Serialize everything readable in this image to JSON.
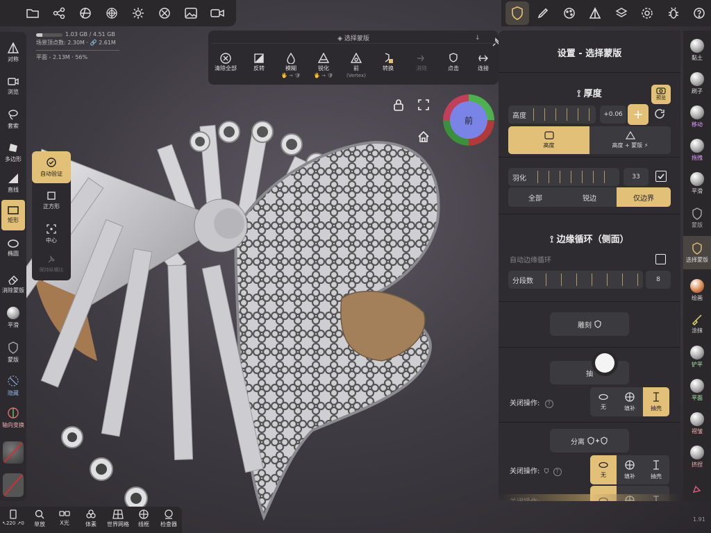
{
  "stats": {
    "memory": "1.03 GB / 4.51 GB",
    "vertices": "场景顶点数: 2.30M · 🔗 2.61M",
    "plane": "平面 - 2.13M · 56%"
  },
  "left_tools": [
    "对称",
    "浏览",
    "套索",
    "多边形",
    "直线",
    "矩形",
    "椭圆",
    "消除蒙版",
    "平滑",
    "蒙版",
    "隐藏",
    "轴向变换"
  ],
  "left_sub": [
    "自动验证",
    "正方形",
    "中心",
    "保持纵横比"
  ],
  "mask_bar": {
    "title": "选择蒙版",
    "buttons": [
      {
        "label": "清除全部",
        "sub": ""
      },
      {
        "label": "反转",
        "sub": ""
      },
      {
        "label": "模糊",
        "sub": "🖐 → 🛡"
      },
      {
        "label": "锐化",
        "sub": "🖐 → 🛡"
      },
      {
        "label": "前",
        "sub": "(Vertex)"
      },
      {
        "label": "转换",
        "sub": ""
      },
      {
        "label": "消除",
        "sub": ""
      },
      {
        "label": "点击",
        "sub": ""
      },
      {
        "label": "连接",
        "sub": ""
      }
    ]
  },
  "view_cube": {
    "label": "前"
  },
  "panel": {
    "title": "设置 - 选择蒙版",
    "thickness": {
      "heading": "厚度",
      "preview": "预览",
      "slider_label": "高度",
      "value": "+0.06",
      "mode_a": "高度",
      "mode_b": "高度 + 蒙版 ⚡"
    },
    "feather": {
      "label": "羽化",
      "value": "33",
      "options": [
        "全部",
        "锐边",
        "仅边界"
      ]
    },
    "edge_loop": {
      "heading": "边缘循环（侧面）",
      "auto": "自动边缘循环",
      "slider_label": "分段数",
      "value": "8"
    },
    "carve": "雕刻",
    "extract": "抽",
    "close_op": "关闭操作:",
    "close_options": [
      "无",
      "填补",
      "抽壳"
    ],
    "split": "分离"
  },
  "right_tools": [
    "黏土",
    "刷子",
    "移动",
    "拖拽",
    "平滑",
    "蒙版",
    "选择蒙版",
    "绘画",
    "涂抹",
    "铲平",
    "平面",
    "褶皱",
    "挤捏"
  ],
  "bottom_tools": [
    "单放",
    "X光",
    "体素",
    "世界网格",
    "线框",
    "检查器"
  ],
  "bottom_left": "↖220 ↗0",
  "version": "1.91"
}
